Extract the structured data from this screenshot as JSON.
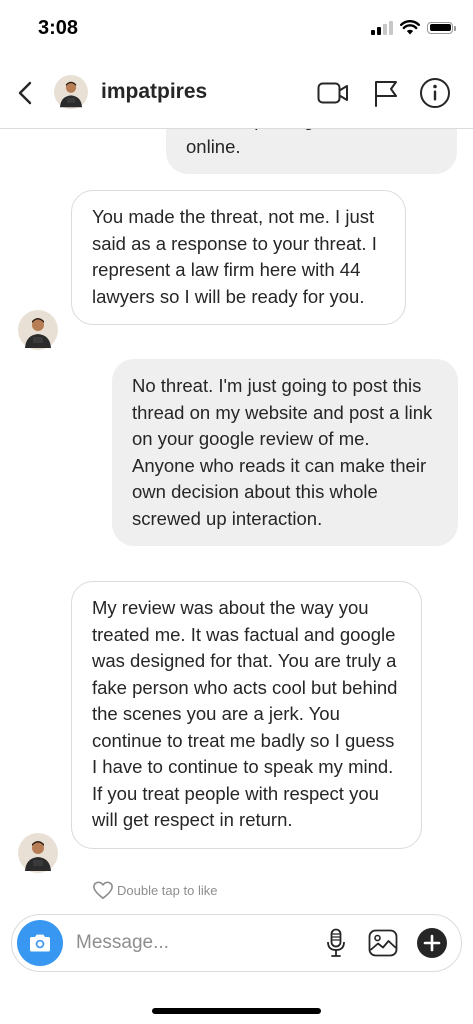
{
  "status_bar": {
    "time": "3:08"
  },
  "header": {
    "username": "impatpires",
    "icons": [
      "back-chevron-icon",
      "video-camera-icon",
      "flag-icon",
      "info-icon"
    ]
  },
  "messages": [
    {
      "direction": "sent",
      "text": "I'm also posting this thread online."
    },
    {
      "direction": "received",
      "text": "You made the threat, not me.  I just said as a response to your threat.  I represent a law firm here with 44 lawyers so I will be ready for you."
    },
    {
      "direction": "sent",
      "text": "No threat. I'm just going to post this thread on my website and post a link on your google review of me. Anyone who reads it can make their own decision about this whole screwed up interaction."
    },
    {
      "direction": "received",
      "text": "My review was about the way you treated me.  It was factual and google was designed for that.  You are truly a fake person who acts cool but behind the scenes you are a jerk.  You continue to treat me badly so I guess I have to continue to speak my mind.  If you treat people with respect you will get respect in return."
    }
  ],
  "like_hint": "Double tap to like",
  "composer": {
    "placeholder": "Message...",
    "value": "",
    "icons": [
      "camera-icon",
      "microphone-icon",
      "gallery-icon",
      "plus-icon"
    ]
  },
  "colors": {
    "accent": "#3897f0",
    "sent_bubble": "#efefef",
    "border": "#dbdbdb",
    "muted_text": "#8e8e8e"
  }
}
